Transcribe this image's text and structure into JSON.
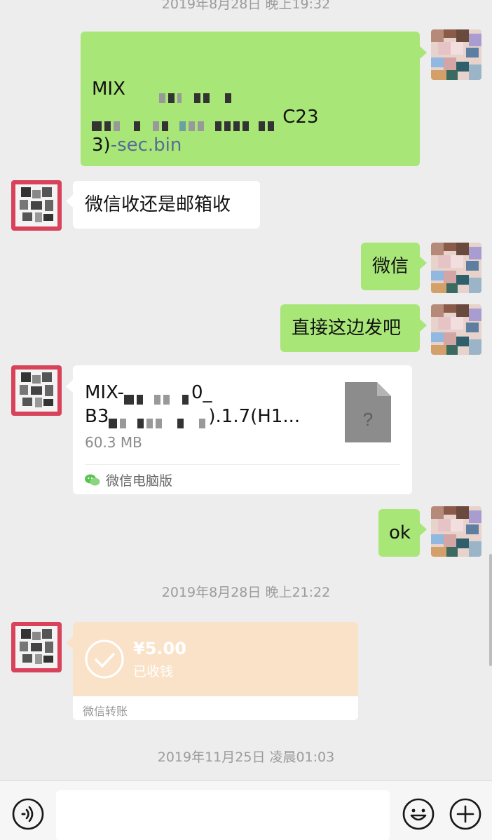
{
  "timestamps": {
    "top_partial": "2019年8月28日 晚上19:32",
    "middle": "2019年8月28日 晚上21:22",
    "bottom": "2019年11月25日 凌晨01:03"
  },
  "messages": {
    "m1": {
      "line1": "MIX",
      "line2_tail": "C23",
      "line3_a": "3)",
      "line3_link": "-sec.bin"
    },
    "m2": {
      "text": "微信收还是邮箱收"
    },
    "m3": {
      "text": "微信"
    },
    "m4": {
      "text": "直接这边发吧"
    },
    "m5": {
      "file_line1_prefix": "MIX-",
      "file_line1_suffix": "0_",
      "file_line2_prefix": "B3",
      "file_line2_suffix": ").1.7(H1...",
      "file_size": "60.3 MB",
      "source": "微信电脑版",
      "icon": "unknown-file-icon"
    },
    "m6": {
      "text": "ok"
    },
    "m7": {
      "amount": "¥5.00",
      "status": "已收钱",
      "footer": "微信转账"
    }
  },
  "icons": {
    "voice": "voice-icon",
    "emoji": "emoji-icon",
    "more": "plus-icon"
  },
  "colors": {
    "bg": "#ededed",
    "green_bubble": "#a8e677",
    "white_bubble": "#ffffff",
    "transfer_peach": "#fae2c9",
    "link": "#576b95"
  }
}
